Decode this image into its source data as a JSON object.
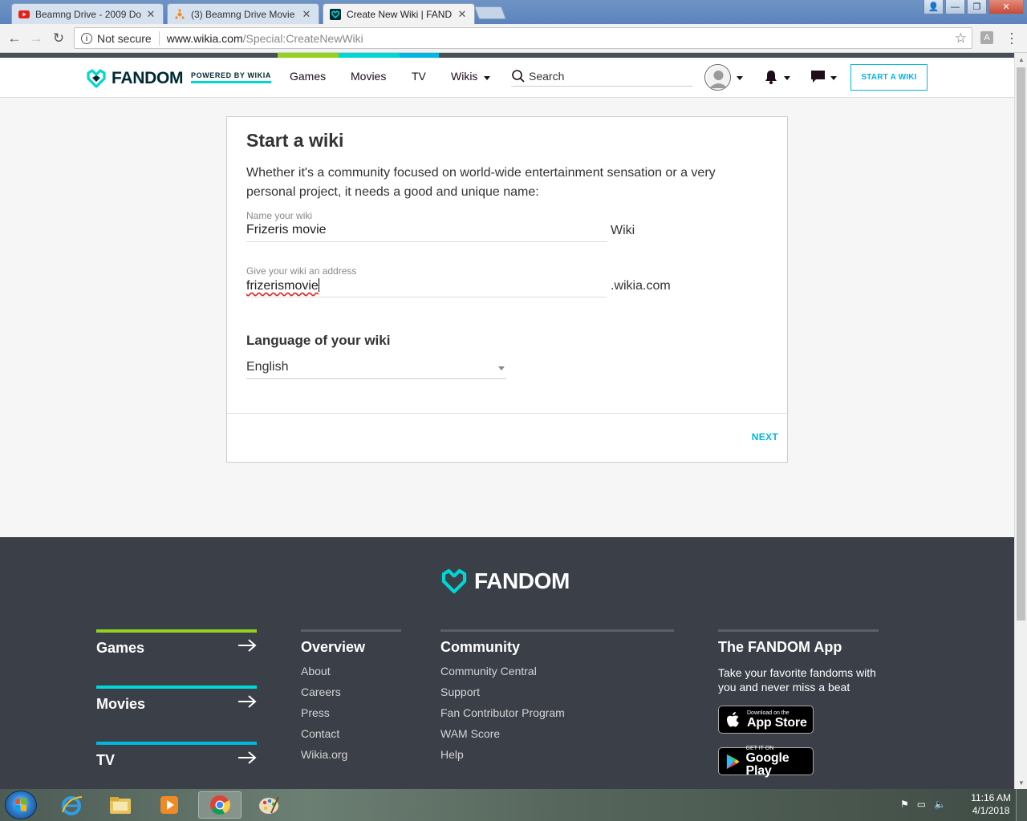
{
  "browser": {
    "tabs": [
      {
        "title": "Beamng Drive - 2009 Do",
        "favicon": "youtube-icon"
      },
      {
        "title": "(3) Beamng Drive Movie",
        "favicon": "deviantart-icon"
      },
      {
        "title": "Create New Wiki | FAND",
        "favicon": "fandom-icon"
      }
    ],
    "security_label": "Not secure",
    "url_host": "www.wikia.com",
    "url_path": "/Special:CreateNewWiki"
  },
  "header": {
    "logo_text": "FANDOM",
    "powered_by": "POWERED BY WIKIA",
    "nav": [
      "Games",
      "Movies",
      "TV",
      "Wikis"
    ],
    "search_placeholder": "Search",
    "start_wiki_button": "START A WIKI",
    "accent_colors": [
      "#94d11f",
      "#00d6d6",
      "#00b7e0"
    ]
  },
  "form": {
    "title": "Start a wiki",
    "intro": "Whether it's a community focused on world-wide entertainment sensation or a very personal project, it needs a good and unique name:",
    "name_label": "Name your wiki",
    "name_value": "Frizeris movie",
    "name_suffix": "Wiki",
    "address_label": "Give your wiki an address",
    "address_value": "frizerismovie",
    "address_suffix": ".wikia.com",
    "language_heading": "Language of your wiki",
    "language_value": "English",
    "next_button": "NEXT"
  },
  "footer": {
    "logo_text": "FANDOM",
    "verticals": [
      {
        "label": "Games",
        "color": "#94d11f"
      },
      {
        "label": "Movies",
        "color": "#00d6d6"
      },
      {
        "label": "TV",
        "color": "#00b7e0"
      }
    ],
    "overview": {
      "title": "Overview",
      "links": [
        "About",
        "Careers",
        "Press",
        "Contact",
        "Wikia.org"
      ]
    },
    "community": {
      "title": "Community",
      "links": [
        "Community Central",
        "Support",
        "Fan Contributor Program",
        "WAM Score",
        "Help"
      ]
    },
    "app": {
      "title": "The FANDOM App",
      "text": "Take your favorite fandoms with you and never miss a beat",
      "appstore_small": "Download on the",
      "appstore_big": "App Store",
      "googleplay_small": "GET IT ON",
      "googleplay_big": "Google Play"
    }
  },
  "taskbar": {
    "time": "11:16 AM",
    "date": "4/1/2018"
  }
}
